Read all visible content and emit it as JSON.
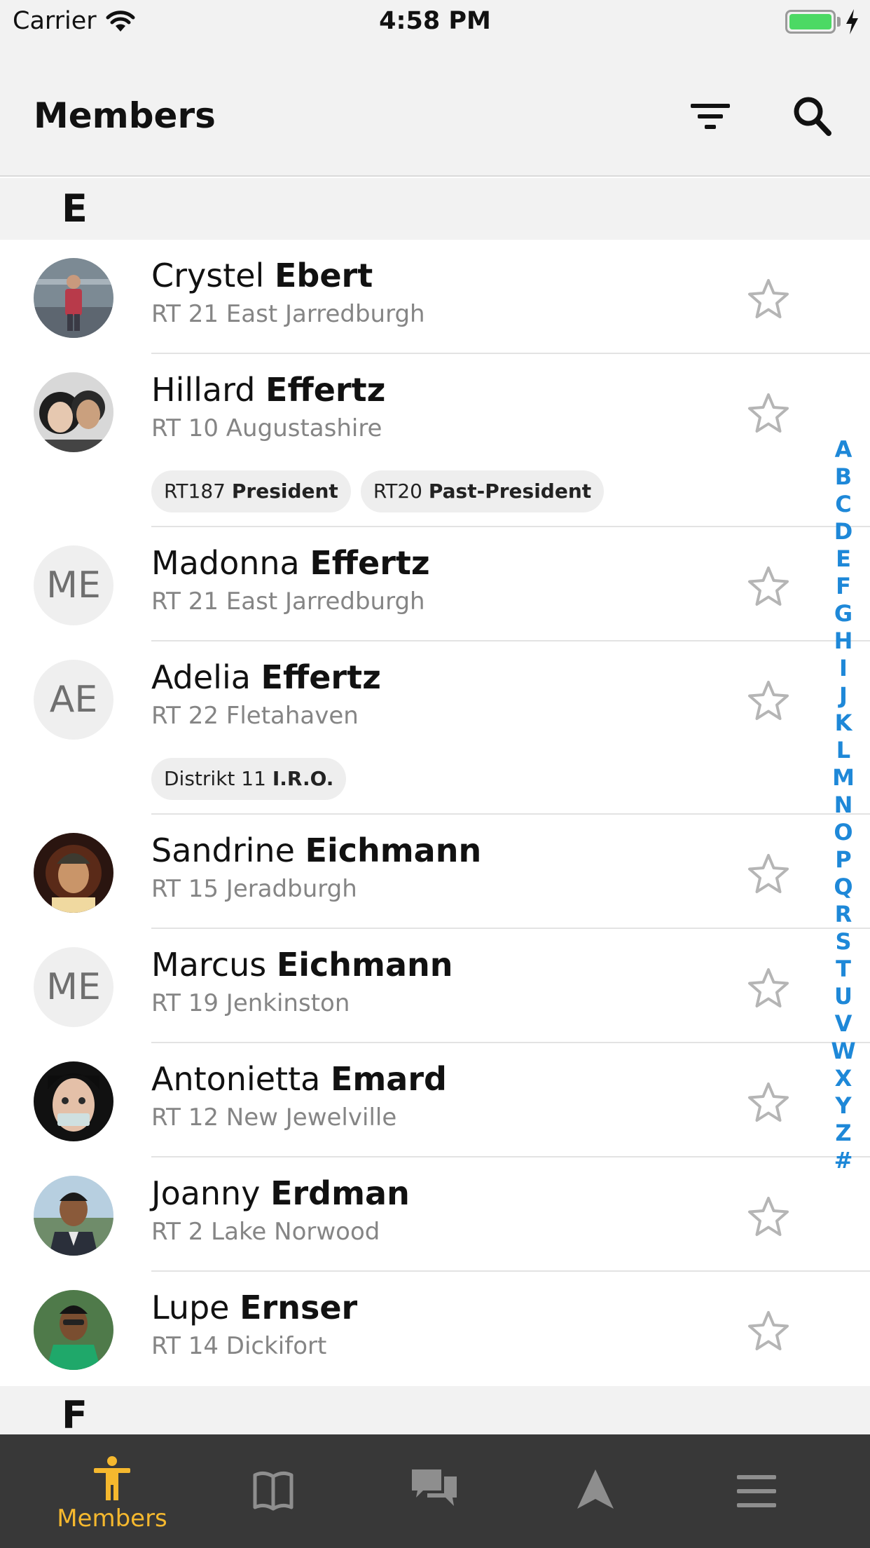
{
  "status_bar": {
    "carrier": "Carrier",
    "time": "4:58 PM"
  },
  "nav": {
    "title": "Members"
  },
  "sections": {
    "e": "E",
    "f": "F"
  },
  "members": [
    {
      "first": "Crystel",
      "last": "Ebert",
      "sub": "RT 21 East Jarredburgh"
    },
    {
      "first": "Hillard",
      "last": "Effertz",
      "sub": "RT 10 Augustashire",
      "tags": [
        {
          "prefix": "RT187",
          "role": "President"
        },
        {
          "prefix": "RT20",
          "role": "Past-President"
        }
      ]
    },
    {
      "first": "Madonna",
      "last": "Effertz",
      "sub": "RT 21 East Jarredburgh",
      "initials": "ME"
    },
    {
      "first": "Adelia",
      "last": "Effertz",
      "sub": "RT 22 Fletahaven",
      "initials": "AE",
      "tags": [
        {
          "prefix": "Distrikt 11",
          "role": "I.R.O."
        }
      ]
    },
    {
      "first": "Sandrine",
      "last": "Eichmann",
      "sub": "RT 15 Jeradburgh"
    },
    {
      "first": "Marcus",
      "last": "Eichmann",
      "sub": "RT 19 Jenkinston",
      "initials": "ME"
    },
    {
      "first": "Antonietta",
      "last": "Emard",
      "sub": "RT 12 New Jewelville"
    },
    {
      "first": "Joanny",
      "last": "Erdman",
      "sub": "RT 2 Lake Norwood"
    },
    {
      "first": "Lupe",
      "last": "Ernser",
      "sub": "RT 14 Dickifort"
    }
  ],
  "index_letters": [
    "A",
    "B",
    "C",
    "D",
    "E",
    "F",
    "G",
    "H",
    "I",
    "J",
    "K",
    "L",
    "M",
    "N",
    "O",
    "P",
    "Q",
    "R",
    "S",
    "T",
    "U",
    "V",
    "W",
    "X",
    "Y",
    "Z",
    "#"
  ],
  "tabs": {
    "members_label": "Members"
  },
  "icons": {
    "filter": "filter-icon",
    "search": "search-icon",
    "star": "star-outline-icon",
    "tab_members": "person-icon",
    "tab_book": "book-icon",
    "tab_chat": "chat-bubbles-icon",
    "tab_navigate": "navigation-arrow-icon",
    "tab_menu": "hamburger-menu-icon"
  },
  "colors": {
    "accent": "#f5b82e",
    "index": "#1e88d8",
    "tab_bar": "#383838",
    "star": "#b5b5b5"
  }
}
